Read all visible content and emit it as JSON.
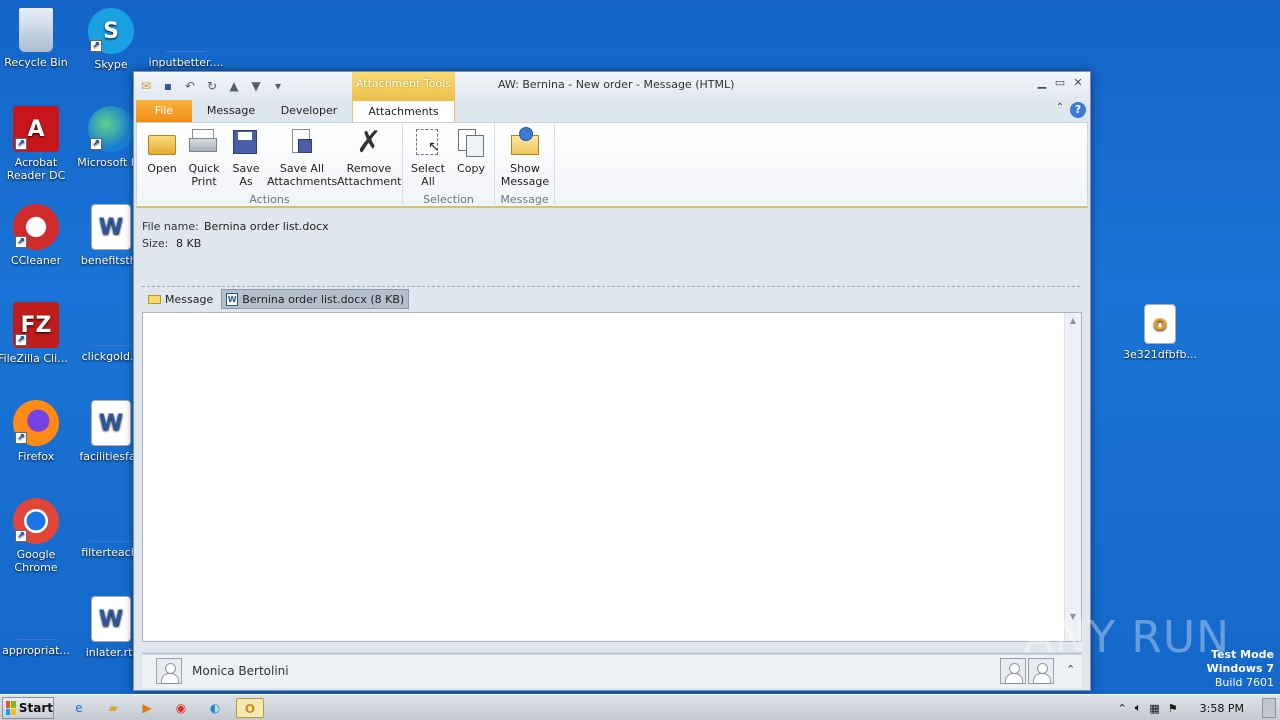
{
  "desktop": {
    "icons": [
      {
        "label": "Recycle Bin"
      },
      {
        "label": "Skype"
      },
      {
        "label": "inputbetter...."
      },
      {
        "label": "Acrobat Reader DC"
      },
      {
        "label": "Microsoft Ed"
      },
      {
        "label": "CCleaner"
      },
      {
        "label": "benefitsthr"
      },
      {
        "label": "FileZilla Client"
      },
      {
        "label": "clickgold.p"
      },
      {
        "label": "Firefox"
      },
      {
        "label": "facilitiesfan"
      },
      {
        "label": "Google Chrome"
      },
      {
        "label": "filterteachi"
      },
      {
        "label": "appropriat..."
      },
      {
        "label": "inlater.rtf"
      },
      {
        "label": "3e321dfbfb..."
      }
    ]
  },
  "window": {
    "title": "AW: Bernina - New order -  Message (HTML)",
    "context_tools": "Attachment Tools",
    "tabs": [
      "File",
      "Message",
      "Developer",
      "Attachments"
    ],
    "ribbon": {
      "groups": [
        {
          "label": "Actions",
          "buttons": [
            {
              "line1": "Open",
              "line2": ""
            },
            {
              "line1": "Quick",
              "line2": "Print"
            },
            {
              "line1": "Save",
              "line2": "As"
            },
            {
              "line1": "Save All",
              "line2": "Attachments"
            },
            {
              "line1": "Remove",
              "line2": "Attachment"
            }
          ]
        },
        {
          "label": "Selection",
          "buttons": [
            {
              "line1": "Select",
              "line2": "All"
            },
            {
              "line1": "Copy",
              "line2": ""
            }
          ]
        },
        {
          "label": "Message",
          "buttons": [
            {
              "line1": "Show",
              "line2": "Message"
            }
          ]
        }
      ]
    },
    "attachment_info": {
      "file_name_label": "File name:",
      "file_name": "Bernina order list.docx",
      "size_label": "Size:",
      "size": "8 KB"
    },
    "attachment_bar": {
      "message_label": "Message",
      "attachment_label": "Bernina order list.docx (8 KB)"
    },
    "people_pane": {
      "sender": "Monica Bertolini"
    }
  },
  "watermark": "ANY RUN",
  "test_mode": {
    "line1": "Test Mode",
    "line2": "Windows 7",
    "line3": "Build 7601"
  },
  "taskbar": {
    "start_label": "Start",
    "clock": "3:58 PM"
  }
}
